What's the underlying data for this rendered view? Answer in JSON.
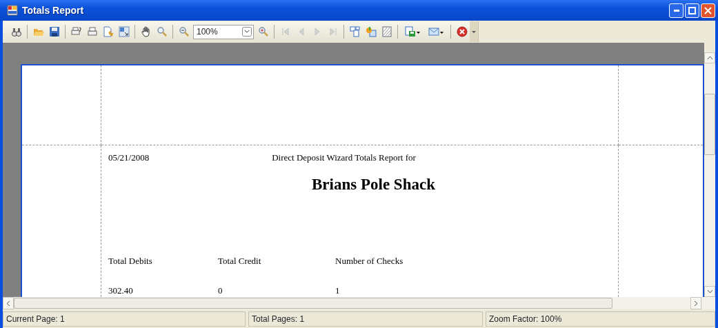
{
  "window": {
    "title": "Totals Report"
  },
  "toolbar": [
    {
      "kind": "find",
      "disabled": false
    },
    {
      "kind": "separator"
    },
    {
      "kind": "open",
      "disabled": false
    },
    {
      "kind": "save",
      "disabled": false
    },
    {
      "kind": "separator"
    },
    {
      "kind": "print-setup",
      "disabled": false
    },
    {
      "kind": "print",
      "disabled": false
    },
    {
      "kind": "page-setup",
      "disabled": false
    },
    {
      "kind": "resize",
      "disabled": false
    },
    {
      "kind": "separator"
    },
    {
      "kind": "hand",
      "disabled": false
    },
    {
      "kind": "magnifier",
      "disabled": false
    },
    {
      "kind": "separator"
    },
    {
      "kind": "zoom-out",
      "disabled": false
    },
    {
      "kind": "zoom-field",
      "value": "100%"
    },
    {
      "kind": "zoom-in",
      "disabled": false
    },
    {
      "kind": "separator"
    },
    {
      "kind": "first",
      "disabled": true
    },
    {
      "kind": "prev",
      "disabled": true
    },
    {
      "kind": "next",
      "disabled": true
    },
    {
      "kind": "last",
      "disabled": true
    },
    {
      "kind": "separator"
    },
    {
      "kind": "group-tree",
      "disabled": false
    },
    {
      "kind": "highlight",
      "disabled": false
    },
    {
      "kind": "watermark",
      "disabled": false
    },
    {
      "kind": "separator"
    },
    {
      "kind": "export",
      "disabled": false
    },
    {
      "kind": "email",
      "disabled": false
    },
    {
      "kind": "separator"
    },
    {
      "kind": "stop",
      "disabled": false
    },
    {
      "kind": "overflow"
    }
  ],
  "report": {
    "date": "05/21/2008",
    "heading": "Direct Deposit Wizard Totals Report for",
    "company": "Brians Pole Shack",
    "columns": [
      {
        "label": "Total Debits",
        "value": "302.40"
      },
      {
        "label": "Total Credit",
        "value": "0"
      },
      {
        "label": "Number of Checks",
        "value": "1"
      }
    ]
  },
  "status_bar": [
    "Current Page: 1",
    "Total Pages: 1",
    "Zoom Factor: 100%"
  ]
}
